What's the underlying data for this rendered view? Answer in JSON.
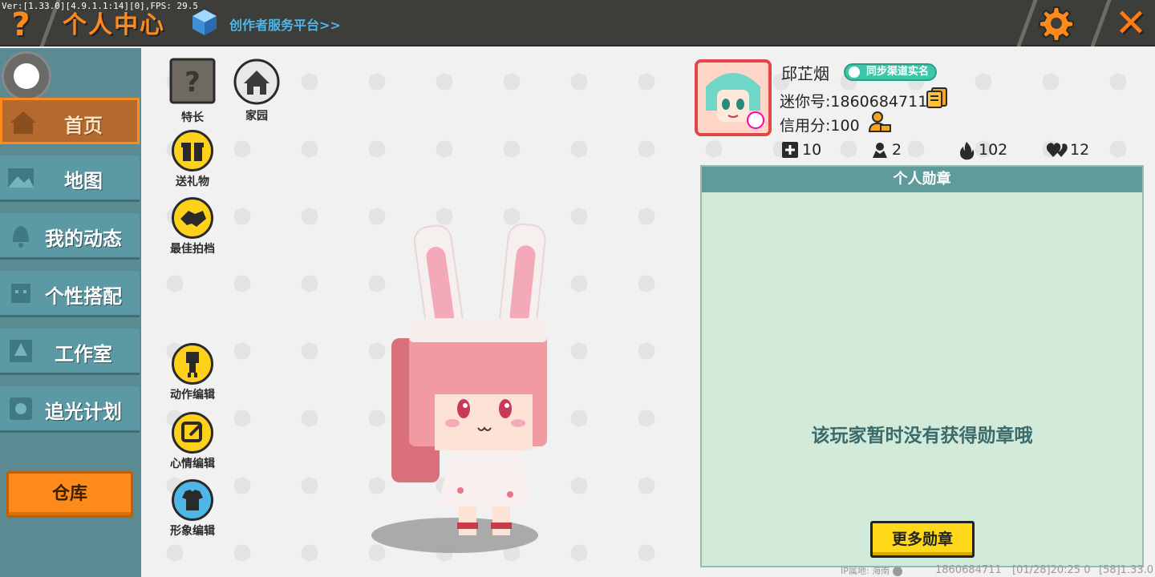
{
  "debug_text": "Ver:[1.33.0][4.9.1.1:14][0],FPS: 29.5",
  "header": {
    "help_label": "?",
    "title": "个人中心",
    "creator_link": "创作者服务平台>>",
    "close_label": "✕"
  },
  "sidebar": {
    "items": [
      {
        "label": "首页",
        "active": true
      },
      {
        "label": "地图"
      },
      {
        "label": "我的动态"
      },
      {
        "label": "个性搭配"
      },
      {
        "label": "工作室"
      },
      {
        "label": "追光计划"
      }
    ],
    "warehouse_label": "仓库"
  },
  "actions": {
    "talent": "特长",
    "home": "家园",
    "send_gift": "送礼物",
    "best_partner": "最佳拍档",
    "action_edit": "动作编辑",
    "mood_edit": "心情编辑",
    "image_edit": "形象编辑"
  },
  "profile": {
    "nickname": "邱芷烟",
    "verify_badge": "同步渠道实名",
    "mini_id": "迷你号:1860684711",
    "credit": "信用分:100",
    "stats": {
      "plus": "10",
      "fans": "2",
      "fire": "102",
      "likes": "12"
    }
  },
  "medals": {
    "title": "个人勋章",
    "empty_text": "该玩家暂时没有获得勋章哦",
    "more_button": "更多勋章"
  },
  "footer": {
    "ip": "IP属地: 海南",
    "uid": "1860684711",
    "time": "[01/28]20:25 0",
    "version": "[58]1.33.0"
  },
  "colors": {
    "accent_orange": "#ff8a1c",
    "sidebar_teal": "#5b9aa5",
    "panel_green": "#d2ead9",
    "button_yellow": "#ffd81a"
  }
}
